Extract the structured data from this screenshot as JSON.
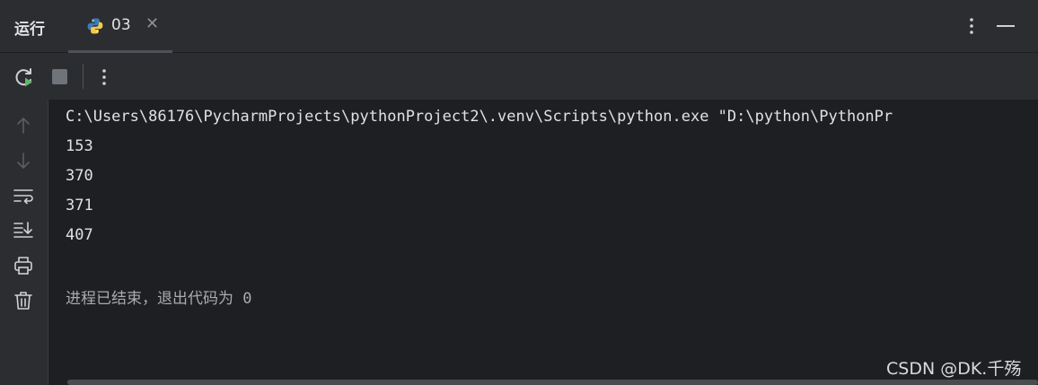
{
  "tool_window": {
    "title": "运行",
    "tab": {
      "label": "03",
      "icon": "python-icon"
    }
  },
  "toolbar": {
    "icons": [
      "rerun-icon",
      "stop-icon",
      "more-options-icon"
    ]
  },
  "sidebar": {
    "icons": [
      "arrow-up-icon",
      "arrow-down-icon",
      "soft-wrap-icon",
      "scroll-to-end-icon",
      "print-icon",
      "trash-icon"
    ]
  },
  "console": {
    "command": "C:\\Users\\86176\\PycharmProjects\\pythonProject2\\.venv\\Scripts\\python.exe \"D:\\python\\PythonPr",
    "output": [
      "153",
      "370",
      "371",
      "407"
    ],
    "finish_message": "进程已结束，退出代码为 0"
  },
  "watermark": "CSDN @DK.千殇",
  "colors": {
    "background": "#1e1f22",
    "panel": "#2b2d30",
    "text": "#dfe1e5",
    "run_green": "#5fb865"
  }
}
